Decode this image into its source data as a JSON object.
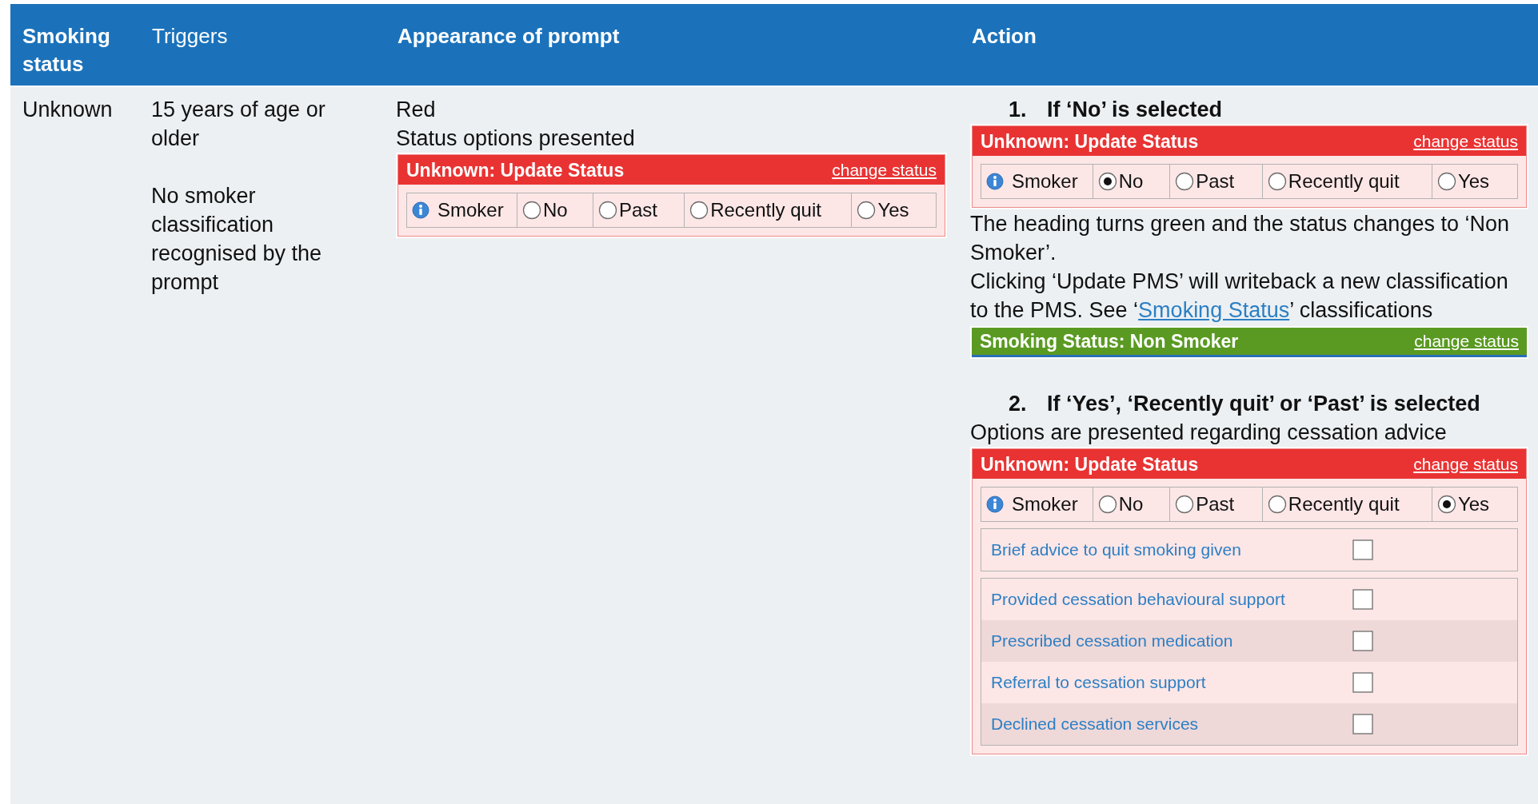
{
  "table": {
    "columns": [
      {
        "label": "Smoking status",
        "bold": true
      },
      {
        "label": "Triggers",
        "bold": false
      },
      {
        "label": "Appearance of prompt",
        "bold": true
      },
      {
        "label": "Action",
        "bold": true
      }
    ],
    "row": {
      "smoking_status": "Unknown",
      "triggers": [
        "15 years of age or older",
        "No smoker classification recognised by the prompt"
      ],
      "appearance": [
        {
          "kind": "text",
          "text": "Red"
        },
        {
          "kind": "text",
          "text": "Status options presented"
        },
        {
          "kind": "prompt",
          "color": "#e93333",
          "title": "Unknown: Update Status",
          "link": "change status",
          "info_label": "Smoker",
          "options": [
            {
              "label": "No",
              "selected": false
            },
            {
              "label": "Past",
              "selected": false
            },
            {
              "label": "Recently quit",
              "selected": false
            },
            {
              "label": "Yes",
              "selected": false
            }
          ]
        }
      ],
      "action": [
        {
          "number": "1.",
          "heading": "If ‘No’ is selected",
          "content": [
            {
              "kind": "prompt",
              "color": "#e93333",
              "title": "Unknown: Update Status",
              "link": "change status",
              "info_label": "Smoker",
              "options": [
                {
                  "label": "No",
                  "selected": true
                },
                {
                  "label": "Past",
                  "selected": false
                },
                {
                  "label": "Recently quit",
                  "selected": false
                },
                {
                  "label": "Yes",
                  "selected": false
                }
              ]
            },
            {
              "kind": "text",
              "text": "The heading turns green and the status changes to ‘Non Smoker’."
            },
            {
              "kind": "text",
              "text": "Clicking ‘Update PMS’ will writeback a new classification to the PMS. See ‘",
              "link": "Smoking Status",
              "after": "’ classifications"
            },
            {
              "kind": "prompt",
              "color": "#5a9a22",
              "title": "Smoking Status: Non Smoker",
              "link": "change status"
            }
          ]
        },
        {
          "number": "2.",
          "heading": "If ‘Yes’, ‘Recently quit’ or ‘Past’ is selected",
          "content": [
            {
              "kind": "text",
              "text": "Options are presented regarding cessation advice"
            },
            {
              "kind": "prompt",
              "color": "#e93333",
              "title": "Unknown: Update Status",
              "link": "change status",
              "info_label": "Smoker",
              "options": [
                {
                  "label": "No",
                  "selected": false
                },
                {
                  "label": "Past",
                  "selected": false
                },
                {
                  "label": "Recently quit",
                  "selected": false
                },
                {
                  "label": "Yes",
                  "selected": true
                }
              ],
              "checklist_groups": [
                {
                  "items": [
                    {
                      "label": "Brief advice to quit smoking given",
                      "checked": false
                    }
                  ]
                },
                {
                  "items": [
                    {
                      "label": "Provided cessation behavioural support",
                      "checked": false
                    },
                    {
                      "label": "Prescribed cessation medication",
                      "checked": false
                    },
                    {
                      "label": "Referral to cessation support",
                      "checked": false
                    },
                    {
                      "label": "Declined cessation services",
                      "checked": false
                    }
                  ]
                }
              ]
            }
          ]
        }
      ]
    }
  }
}
